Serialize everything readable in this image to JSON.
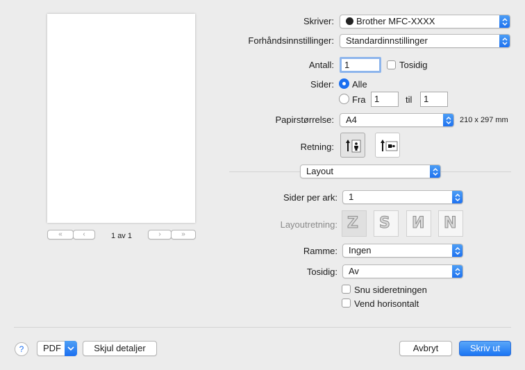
{
  "preview": {
    "page_label": "1 av 1"
  },
  "printer": {
    "label": "Skriver:",
    "value": "Brother MFC-XXXX"
  },
  "presets": {
    "label": "Forhåndsinnstillinger:",
    "value": "Standardinnstillinger"
  },
  "copies": {
    "label": "Antall:",
    "value": "1",
    "two_sided_label": "Tosidig"
  },
  "pages": {
    "label": "Sider:",
    "all_label": "Alle",
    "from_label": "Fra",
    "from_value": "1",
    "to_label": "til",
    "to_value": "1"
  },
  "paper": {
    "label": "Papirstørrelse:",
    "value": "A4",
    "dimensions": "210 x 297 mm"
  },
  "orientation": {
    "label": "Retning:"
  },
  "section": {
    "value": "Layout"
  },
  "layout": {
    "pages_per_sheet_label": "Sider per ark:",
    "pages_per_sheet_value": "1",
    "direction_label": "Layoutretning:",
    "border_label": "Ramme:",
    "border_value": "Ingen",
    "two_sided_label": "Tosidig:",
    "two_sided_value": "Av",
    "reverse_label": "Snu sideretningen",
    "flip_label": "Vend horisontalt"
  },
  "footer": {
    "help": "?",
    "pdf": "PDF",
    "hide_details": "Skjul detaljer",
    "cancel": "Avbryt",
    "print": "Skriv ut"
  },
  "colors": {
    "accent": "#1b6ff0",
    "window": "#ececec"
  }
}
